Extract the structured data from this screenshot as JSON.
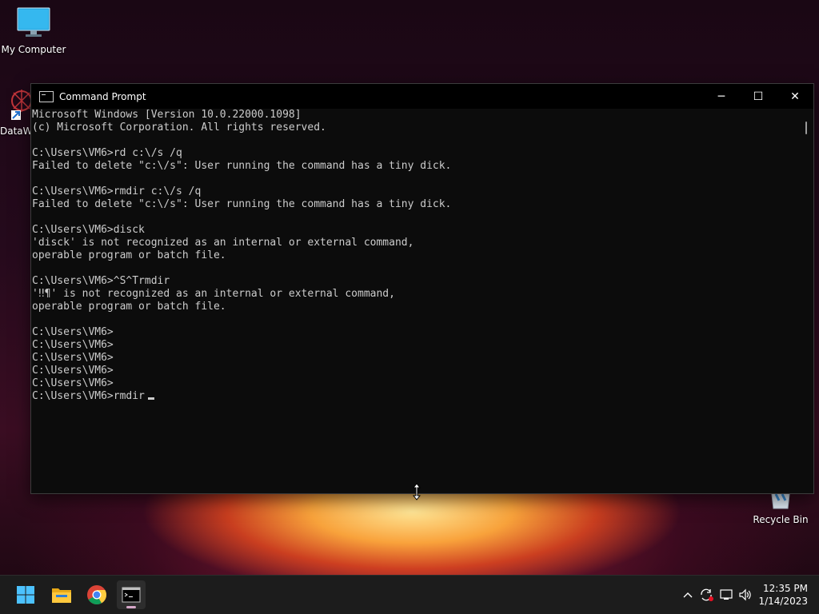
{
  "desktop": {
    "icons": [
      {
        "label": "My Computer"
      },
      {
        "label": "DataW"
      },
      {
        "label": "Recycle Bin"
      }
    ]
  },
  "window": {
    "title": "Command Prompt",
    "controls": {
      "minimize": "─",
      "maximize": "☐",
      "close": "✕"
    }
  },
  "console": {
    "lines": [
      "Microsoft Windows [Version 10.0.22000.1098]",
      "(c) Microsoft Corporation. All rights reserved.",
      "",
      "C:\\Users\\VM6>rd c:\\/s /q",
      "Failed to delete \"c:\\/s\": User running the command has a tiny dick.",
      "",
      "C:\\Users\\VM6>rmdir c:\\/s /q",
      "Failed to delete \"c:\\/s\": User running the command has a tiny dick.",
      "",
      "C:\\Users\\VM6>disck",
      "'disck' is not recognized as an internal or external command,",
      "operable program or batch file.",
      "",
      "C:\\Users\\VM6>^S^Trmdir",
      "'‼¶' is not recognized as an internal or external command,",
      "operable program or batch file.",
      "",
      "C:\\Users\\VM6>",
      "C:\\Users\\VM6>",
      "C:\\Users\\VM6>",
      "C:\\Users\\VM6>",
      "C:\\Users\\VM6>",
      "C:\\Users\\VM6>rmdir"
    ]
  },
  "taskbar": {
    "apps": [
      {
        "name": "start-icon"
      },
      {
        "name": "file-explorer-icon"
      },
      {
        "name": "chrome-icon"
      },
      {
        "name": "command-prompt-icon"
      }
    ],
    "tray": {
      "chevron": "^",
      "clock_time": "12:35 PM",
      "clock_date": "1/14/2023"
    }
  },
  "colors": {
    "console_bg": "#0c0c0c",
    "console_fg": "#cccccc",
    "taskbar_bg": "#1c1c1c"
  }
}
